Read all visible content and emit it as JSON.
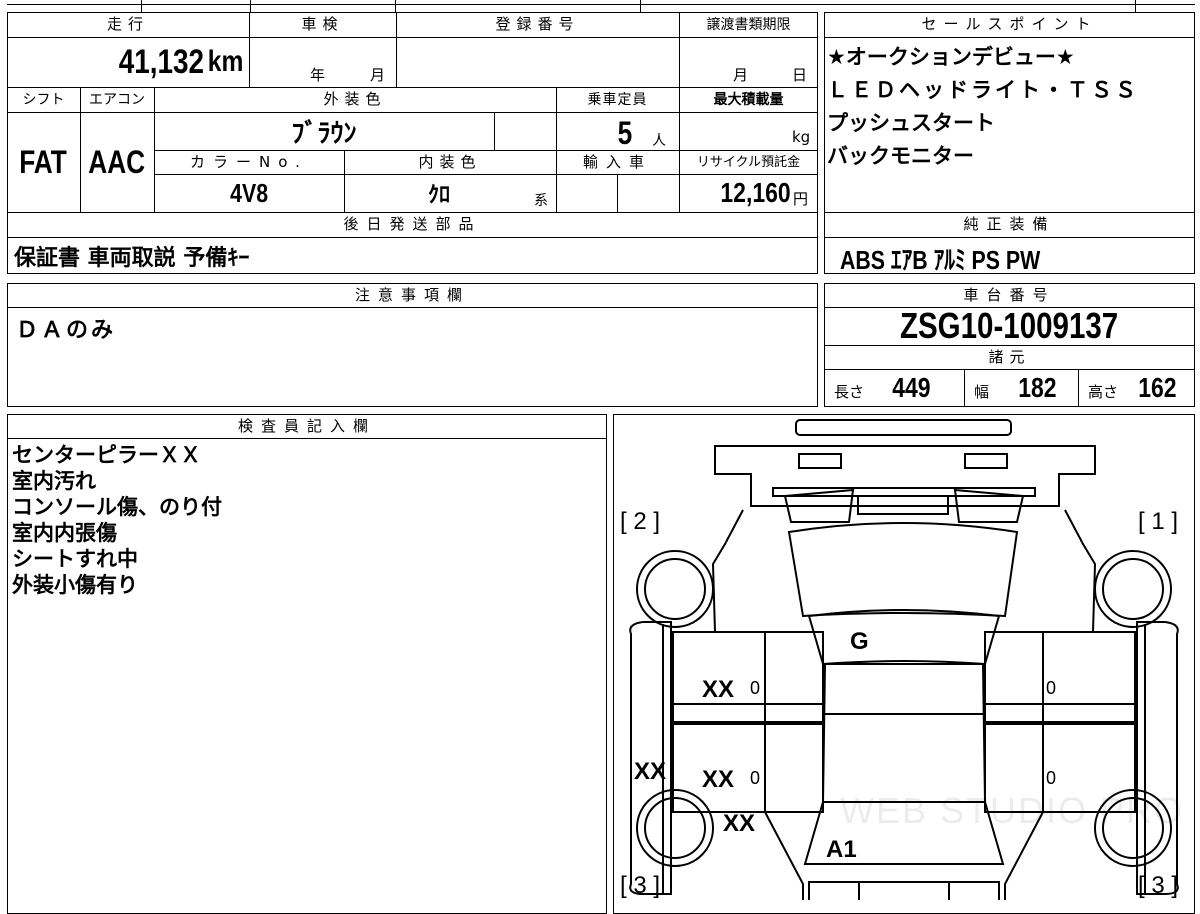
{
  "top": {
    "mileage_label": "走行",
    "mileage": "41,132",
    "mileage_unit": "km",
    "inspection_label": "車検",
    "year_unit": "年",
    "month_unit": "月",
    "reg_label": "登録番号",
    "reg_value": "",
    "transfer_label": "譲渡書類期限",
    "transfer_month": "月",
    "transfer_day": "日"
  },
  "spec": {
    "shift_label": "シフト",
    "shift": "FAT",
    "ac_label": "エアコン",
    "ac": "AAC",
    "exterior_label": "外装色",
    "exterior": "ﾌﾞﾗｳﾝ",
    "capacity_label": "乗車定員",
    "capacity": "5",
    "capacity_unit": "人",
    "maxload_label": "最大積載量",
    "maxload_unit": "kg",
    "colorno_label": "カラーNo.",
    "colorno": "4V8",
    "interior_label": "内装色",
    "interior": "ｸﾛ",
    "interior_unit": "系",
    "import_label": "輸入車",
    "recycle_label": "リサイクル預託金",
    "recycle": "12,160",
    "recycle_unit": "円"
  },
  "later_parts": {
    "label": "後日発送部品",
    "value": "保証書 車両取説 予備ｷｰ"
  },
  "sales": {
    "label": "セールスポイント",
    "lines": [
      "★オークションデビュー★",
      "ＬＥＤヘッドライト・ＴＳＳ",
      "プッシュスタート",
      "バックモニター"
    ]
  },
  "equip": {
    "label": "純正装備",
    "value": "ABS ｴｱB ｱﾙﾐ PS PW"
  },
  "caution": {
    "label": "注意事項欄",
    "value": "ＤＡのみ"
  },
  "chassis": {
    "label": "車台番号",
    "value": "ZSG10-1009137"
  },
  "dims": {
    "label": "諸元",
    "length_label": "長さ",
    "length": "449",
    "width_label": "幅",
    "width": "182",
    "height_label": "高さ",
    "height": "162"
  },
  "inspector": {
    "label": "検査員記入欄",
    "lines": [
      "センターピラーＸＸ",
      "室内汚れ",
      "コンソール傷、のり付",
      "室内内張傷",
      "シートすれ中",
      "外装小傷有り"
    ]
  },
  "diagram": {
    "corner_2": "[ 2 ]",
    "corner_1": "[ 1 ]",
    "corner_3l": "[ 3 ]",
    "corner_3r": "[ 3 ]",
    "hood": "G",
    "roof": "A1",
    "marks": [
      "XX",
      "XX",
      "XX",
      "XX"
    ],
    "zero": "0",
    "watermark": "WEB STUDIO PRO"
  }
}
